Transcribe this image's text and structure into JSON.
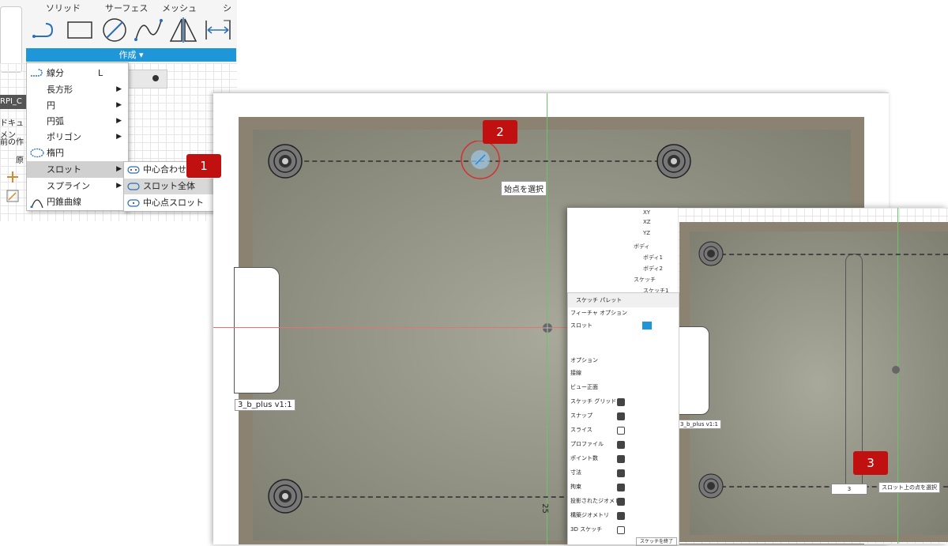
{
  "toolbar": {
    "tabs": [
      "ソリッド",
      "サーフェス",
      "メッシュ",
      "シー"
    ],
    "create_label": "作成 ▾"
  },
  "left_panel": {
    "labels": [
      "RPI_C",
      "ドキュメン",
      "前の作",
      "原"
    ]
  },
  "menu": {
    "items": [
      {
        "label": "線分",
        "shortcut": "L",
        "arrow": ""
      },
      {
        "label": "長方形",
        "shortcut": "",
        "arrow": "▶"
      },
      {
        "label": "円",
        "shortcut": "",
        "arrow": "▶"
      },
      {
        "label": "円弧",
        "shortcut": "",
        "arrow": "▶"
      },
      {
        "label": "ポリゴン",
        "shortcut": "",
        "arrow": "▶"
      },
      {
        "label": "楕円",
        "shortcut": "",
        "arrow": ""
      },
      {
        "label": "スロット",
        "shortcut": "",
        "arrow": "▶"
      },
      {
        "label": "スプライン",
        "shortcut": "",
        "arrow": "▶"
      },
      {
        "label": "円錐曲線",
        "shortcut": "",
        "arrow": ""
      }
    ],
    "submenu": [
      "中心合わせス",
      "スロット全体",
      "中心点スロット"
    ]
  },
  "steps": [
    "1",
    "2",
    "3"
  ],
  "canvas": {
    "hint_start": "始点を選択",
    "component_label": "3_b_plus v1:1",
    "dimension": "25"
  },
  "panel2": {
    "tree": [
      "XY",
      "XZ",
      "YZ",
      "ボディ",
      "ボディ1",
      "ボディ2",
      "スケッチ",
      "スケッチ1"
    ],
    "palette_title": "スケッチ パレット",
    "feature_options": "フィーチャ オプション",
    "slot_label": "スロット",
    "options_header": "オプション",
    "options": [
      "接線",
      "ビュー正面",
      "スケッチ グリッド",
      "スナップ",
      "スライス",
      "プロファイル",
      "ポイント数",
      "寸法",
      "拘束",
      "投影されたジオメトリ",
      "構築ジオメトリ",
      "3D スケッチ"
    ],
    "option_states": [
      false,
      false,
      true,
      true,
      false,
      true,
      true,
      true,
      true,
      true,
      true,
      false
    ],
    "finish_button": "スケッチを終了",
    "component_label": "3_b_plus v1:1",
    "input_value": "3",
    "hint_point": "スロット上の点を選択"
  },
  "colors": {
    "accent": "#1e96d8",
    "badge": "#c01010",
    "part": "#8b8272"
  }
}
